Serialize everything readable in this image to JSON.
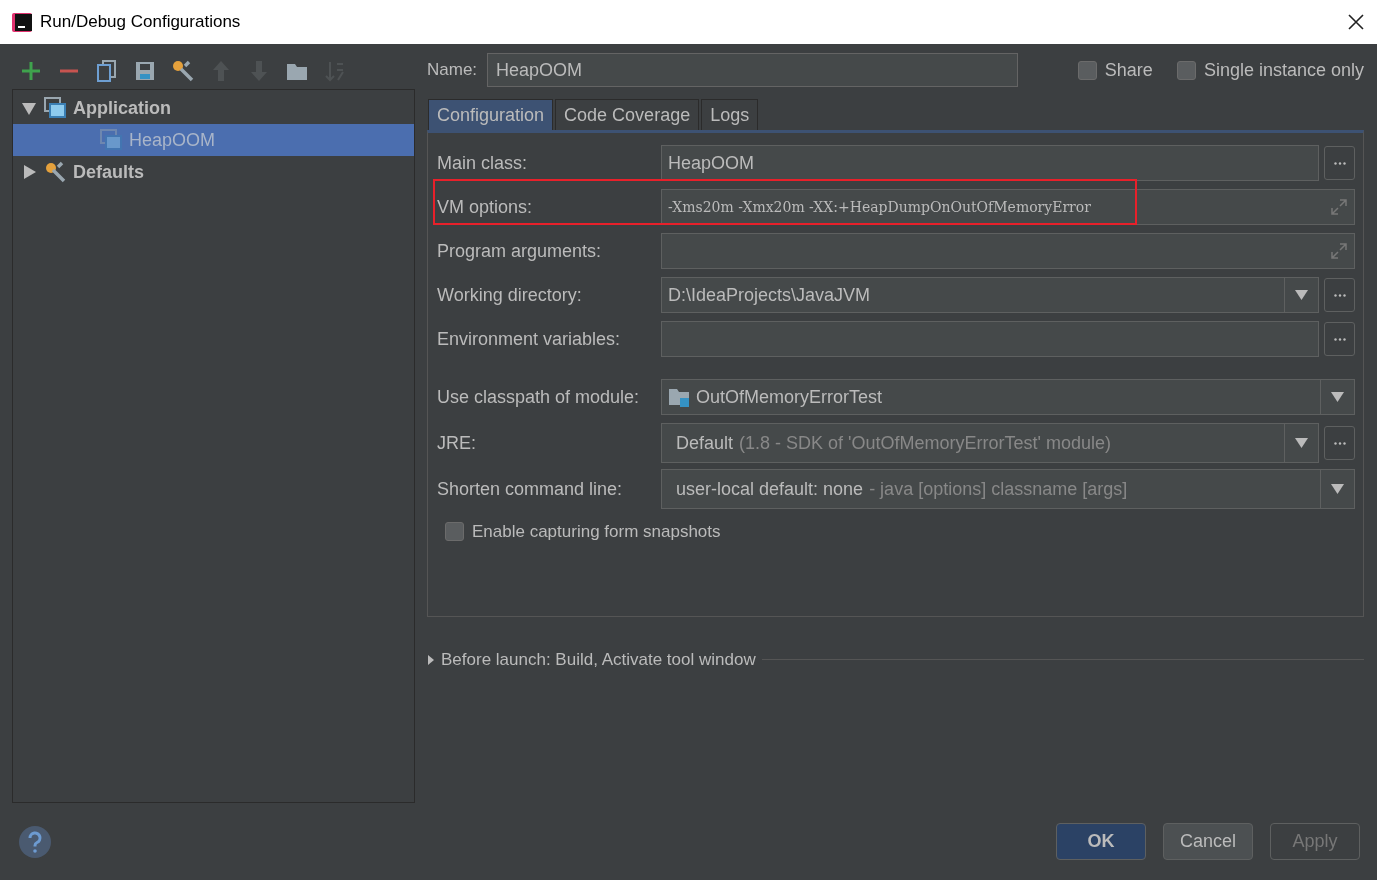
{
  "window": {
    "title": "Run/Debug Configurations"
  },
  "toolbar": [
    {
      "kind": "add",
      "disabled": false
    },
    {
      "kind": "remove",
      "disabled": false
    },
    {
      "kind": "copy",
      "disabled": false
    },
    {
      "kind": "save",
      "disabled": false
    },
    {
      "kind": "wrench",
      "disabled": false
    },
    {
      "kind": "up",
      "disabled": true
    },
    {
      "kind": "down",
      "disabled": true
    },
    {
      "kind": "folder",
      "disabled": false
    },
    {
      "kind": "sort",
      "disabled": true
    }
  ],
  "tree": [
    {
      "label": "Application",
      "kind": "app",
      "expanded": true,
      "selected": false,
      "children": [
        {
          "label": "HeapOOM",
          "kind": "app",
          "selected": true
        }
      ]
    },
    {
      "label": "Defaults",
      "kind": "wrench",
      "expanded": false,
      "selected": false
    }
  ],
  "name": {
    "label": "Name:",
    "value": "HeapOOM"
  },
  "options": [
    {
      "label": "Share",
      "checked": false
    },
    {
      "label": "Single instance only",
      "checked": false
    }
  ],
  "tabs": [
    {
      "label": "Configuration",
      "selected": true
    },
    {
      "label": "Code Coverage",
      "selected": false
    },
    {
      "label": "Logs",
      "selected": false
    }
  ],
  "fields": [
    {
      "label": "Main class:",
      "kind": "text",
      "value": "HeapOOM",
      "browse": true,
      "highlighted": false
    },
    {
      "label": "VM options:",
      "kind": "expand",
      "value": "-Xms20m -Xmx20m -XX:+HeapDumpOnOutOfMemoryError",
      "browse": false,
      "highlighted": true
    },
    {
      "label": "Program arguments:",
      "kind": "expand",
      "browse": false,
      "highlighted": false
    },
    {
      "label": "Working directory:",
      "kind": "combo",
      "value": "D:\\IdeaProjects\\JavaJVM",
      "browse": true,
      "highlighted": false
    },
    {
      "label": "Environment variables:",
      "kind": "text",
      "browse": true,
      "highlighted": false
    },
    {
      "label": "Use classpath of module:",
      "kind": "module",
      "value": "OutOfMemoryErrorTest",
      "browse": false,
      "highlighted": false
    },
    {
      "label": "JRE:",
      "kind": "combo",
      "value": "Default",
      "hint": "(1.8 - SDK of 'OutOfMemoryErrorTest' module)",
      "browse": true,
      "highlighted": false
    },
    {
      "label": "Shorten command line:",
      "kind": "combo",
      "value": "user-local default: none",
      "hint": "- java [options] classname [args]",
      "browse": false,
      "highlighted": false
    }
  ],
  "snapshot": {
    "label": "Enable capturing form snapshots",
    "checked": false
  },
  "before_launch": {
    "label": "Before launch: Build, Activate tool window",
    "expanded": false
  },
  "buttons": [
    {
      "label": "OK",
      "kind": "default",
      "disabled": false
    },
    {
      "label": "Cancel",
      "kind": "normal",
      "disabled": false
    },
    {
      "label": "Apply",
      "kind": "normal",
      "disabled": true
    }
  ]
}
